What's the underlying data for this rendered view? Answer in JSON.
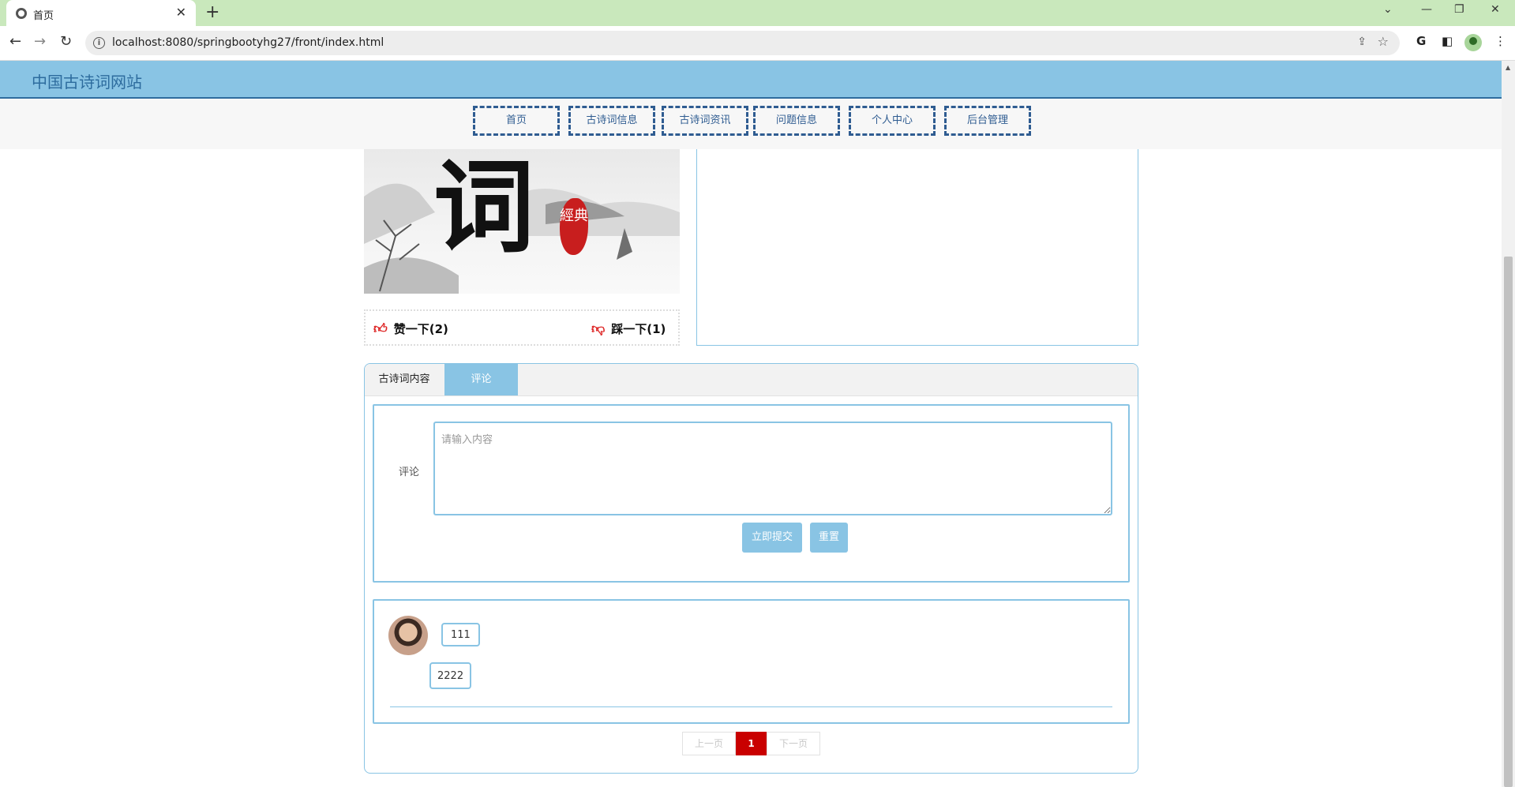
{
  "browser": {
    "tab_title": "首页",
    "url": "localhost:8080/springbootyhg27/front/index.html"
  },
  "site": {
    "title": "中国古诗词网站"
  },
  "nav": {
    "items": [
      {
        "label": "首页"
      },
      {
        "label": "古诗词信息"
      },
      {
        "label": "古诗词资讯"
      },
      {
        "label": "问题信息"
      },
      {
        "label": "个人中心"
      },
      {
        "label": "后台管理"
      }
    ]
  },
  "image": {
    "char": "词",
    "seal": "經典"
  },
  "vote": {
    "like_label": "赞一下(2)",
    "dislike_label": "踩一下(1)"
  },
  "tabs": [
    {
      "label": "古诗词内容"
    },
    {
      "label": "评论"
    }
  ],
  "comment_form": {
    "label": "评论",
    "placeholder": "请输入内容",
    "submit_label": "立即提交",
    "reset_label": "重置"
  },
  "comments": [
    {
      "user": "111",
      "text": "2222"
    }
  ],
  "pagination": {
    "prev": "上一页",
    "current": "1",
    "next": "下一页"
  },
  "colors": {
    "accent": "#89c4e4",
    "nav_border": "#2f5c91",
    "current_page": "#c90000",
    "tabstrip": "#c9e8bc"
  }
}
